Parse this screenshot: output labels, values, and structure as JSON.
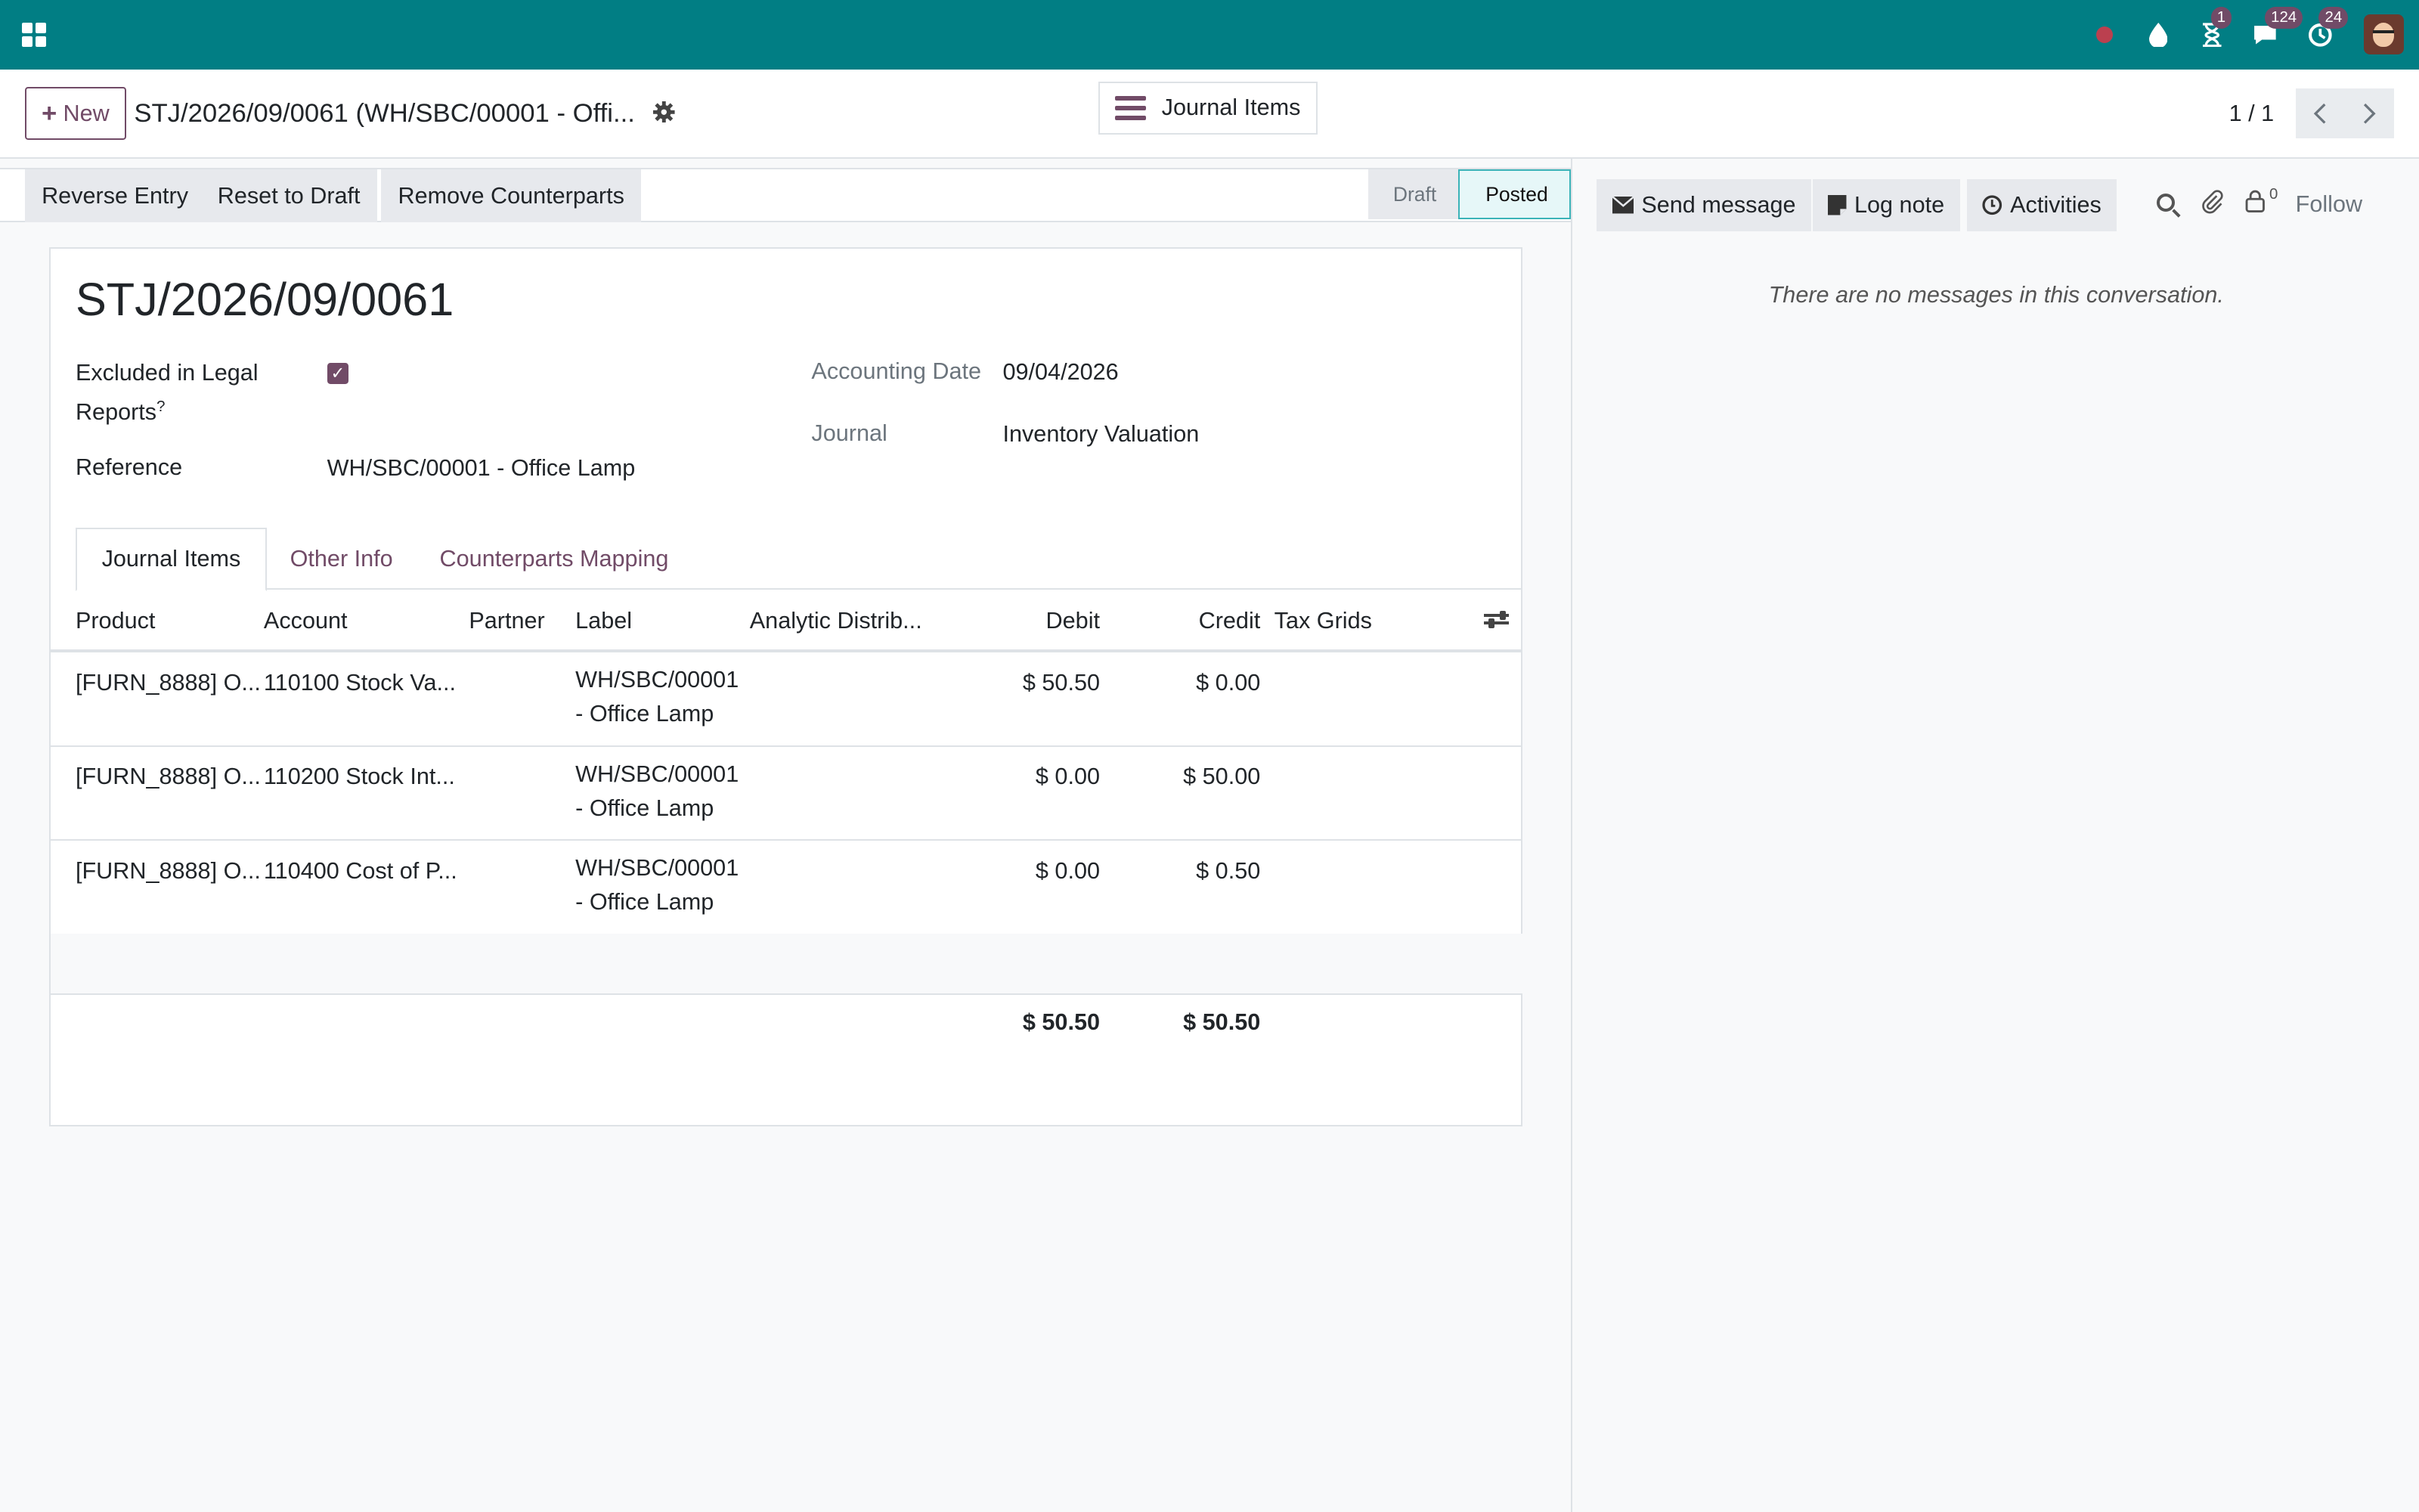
{
  "navbar": {
    "chat_badge": "124",
    "activity_badge": "1",
    "timer_badge": "24"
  },
  "control_panel": {
    "new_label": "New",
    "breadcrumb": "STJ/2026/09/0061 (WH/SBC/00001 - Offi...",
    "smart_button_label": "Journal Items",
    "pager_value": "1 / 1"
  },
  "status_bar": {
    "actions": [
      "Reverse Entry",
      "Reset to Draft",
      "Remove Counterparts"
    ],
    "stages": [
      "Draft",
      "Posted"
    ],
    "current_stage": "Posted"
  },
  "form": {
    "title": "STJ/2026/09/0061",
    "excluded_label_line1": "Excluded in Legal",
    "excluded_label_line2": "Reports",
    "excluded_tooltip_mark": "?",
    "excluded_value": true,
    "reference_label": "Reference",
    "reference_value": "WH/SBC/00001 - Office Lamp",
    "accounting_date_label": "Accounting Date",
    "accounting_date_value": "09/04/2026",
    "journal_label": "Journal",
    "journal_value": "Inventory Valuation"
  },
  "tabs": [
    "Journal Items",
    "Other Info",
    "Counterparts Mapping"
  ],
  "table": {
    "columns": [
      "Product",
      "Account",
      "Partner",
      "Label",
      "Analytic Distrib...",
      "Debit",
      "Credit",
      "Tax Grids"
    ],
    "rows": [
      {
        "product": "[FURN_8888] O...",
        "account": "110100 Stock Va...",
        "partner": "",
        "label_line1": "WH/SBC/00001",
        "label_line2": "- Office Lamp",
        "analytic": "",
        "debit": "$ 50.50",
        "credit": "$ 0.00",
        "tax": ""
      },
      {
        "product": "[FURN_8888] O...",
        "account": "110200 Stock Int...",
        "partner": "",
        "label_line1": "WH/SBC/00001",
        "label_line2": "- Office Lamp",
        "analytic": "",
        "debit": "$ 0.00",
        "credit": "$ 50.00",
        "tax": ""
      },
      {
        "product": "[FURN_8888] O...",
        "account": "110400 Cost of P...",
        "partner": "",
        "label_line1": "WH/SBC/00001",
        "label_line2": "- Office Lamp",
        "analytic": "",
        "debit": "$ 0.00",
        "credit": "$ 0.50",
        "tax": ""
      }
    ],
    "total_debit": "$ 50.50",
    "total_credit": "$ 50.50"
  },
  "chatter": {
    "send_message": "Send message",
    "log_note": "Log note",
    "activities": "Activities",
    "followers_count": "0",
    "follow": "Follow",
    "empty_text": "There are no messages in this conversation."
  }
}
